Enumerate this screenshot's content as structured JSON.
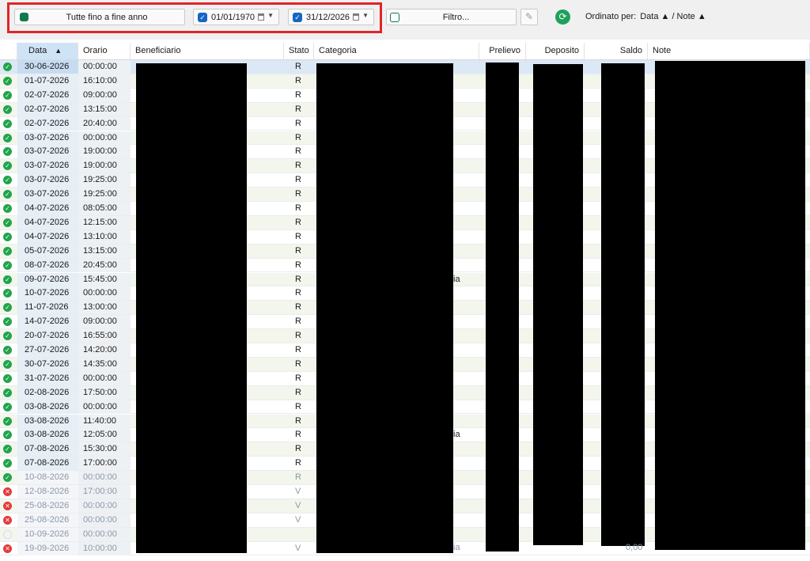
{
  "toolbar": {
    "period_label": "Tutte fino a fine anno",
    "date_from": "01/01/1970",
    "date_to": "31/12/2026",
    "filter_label": "Filtro...",
    "sort_label": "Ordinato per:",
    "sort_value": "Data ▲ / Note ▲"
  },
  "columns": {
    "date": "Data",
    "time": "Orario",
    "payee": "Beneficiario",
    "status": "Stato",
    "category": "Categoria",
    "withdrawal": "Prelievo",
    "deposit": "Deposito",
    "balance": "Saldo",
    "notes": "Note"
  },
  "colors": {
    "accent_green": "#1ea15b",
    "highlight_red": "#e2232a",
    "error": "#e23b3b"
  },
  "rows": [
    {
      "date": "30-06-2026",
      "time": "00:00:00",
      "status": "R",
      "icon": "ok"
    },
    {
      "date": "01-07-2026",
      "time": "16:10:00",
      "status": "R",
      "icon": "ok"
    },
    {
      "date": "02-07-2026",
      "time": "09:00:00",
      "status": "R",
      "icon": "ok"
    },
    {
      "date": "02-07-2026",
      "time": "13:15:00",
      "status": "R",
      "icon": "ok"
    },
    {
      "date": "02-07-2026",
      "time": "20:40:00",
      "status": "R",
      "icon": "ok"
    },
    {
      "date": "03-07-2026",
      "time": "00:00:00",
      "status": "R",
      "icon": "ok"
    },
    {
      "date": "03-07-2026",
      "time": "19:00:00",
      "status": "R",
      "icon": "ok"
    },
    {
      "date": "03-07-2026",
      "time": "19:00:00",
      "status": "R",
      "icon": "ok"
    },
    {
      "date": "03-07-2026",
      "time": "19:25:00",
      "status": "R",
      "icon": "ok"
    },
    {
      "date": "03-07-2026",
      "time": "19:25:00",
      "status": "R",
      "icon": "ok"
    },
    {
      "date": "04-07-2026",
      "time": "08:05:00",
      "status": "R",
      "icon": "ok"
    },
    {
      "date": "04-07-2026",
      "time": "12:15:00",
      "status": "R",
      "icon": "ok"
    },
    {
      "date": "04-07-2026",
      "time": "13:10:00",
      "status": "R",
      "icon": "ok"
    },
    {
      "date": "05-07-2026",
      "time": "13:15:00",
      "status": "R",
      "icon": "ok"
    },
    {
      "date": "08-07-2026",
      "time": "20:45:00",
      "status": "R",
      "icon": "ok"
    },
    {
      "date": "09-07-2026",
      "time": "15:45:00",
      "status": "R",
      "icon": "ok"
    },
    {
      "date": "10-07-2026",
      "time": "00:00:00",
      "status": "R",
      "icon": "ok"
    },
    {
      "date": "11-07-2026",
      "time": "13:00:00",
      "status": "R",
      "icon": "ok"
    },
    {
      "date": "14-07-2026",
      "time": "09:00:00",
      "status": "R",
      "icon": "ok"
    },
    {
      "date": "20-07-2026",
      "time": "16:55:00",
      "status": "R",
      "icon": "ok"
    },
    {
      "date": "27-07-2026",
      "time": "14:20:00",
      "status": "R",
      "icon": "ok"
    },
    {
      "date": "30-07-2026",
      "time": "14:35:00",
      "status": "R",
      "icon": "ok"
    },
    {
      "date": "31-07-2026",
      "time": "00:00:00",
      "status": "R",
      "icon": "ok"
    },
    {
      "date": "02-08-2026",
      "time": "17:50:00",
      "status": "R",
      "icon": "ok"
    },
    {
      "date": "03-08-2026",
      "time": "00:00:00",
      "status": "R",
      "icon": "ok"
    },
    {
      "date": "03-08-2026",
      "time": "11:40:00",
      "status": "R",
      "icon": "ok"
    },
    {
      "date": "03-08-2026",
      "time": "12:05:00",
      "status": "R",
      "icon": "ok"
    },
    {
      "date": "07-08-2026",
      "time": "15:30:00",
      "status": "R",
      "icon": "ok"
    },
    {
      "date": "07-08-2026",
      "time": "17:00:00",
      "status": "R",
      "icon": "ok"
    },
    {
      "date": "10-08-2026",
      "time": "00:00:00",
      "status": "R",
      "icon": "ok"
    },
    {
      "date": "12-08-2026",
      "time": "17:00:00",
      "status": "V",
      "icon": "err"
    },
    {
      "date": "25-08-2026",
      "time": "00:00:00",
      "status": "V",
      "icon": "err"
    },
    {
      "date": "25-08-2026",
      "time": "00:00:00",
      "status": "V",
      "icon": "err"
    },
    {
      "date": "10-09-2026",
      "time": "00:00:00",
      "status": "",
      "icon": "none"
    },
    {
      "date": "19-09-2026",
      "time": "10:00:00",
      "status": "V",
      "icon": "err"
    }
  ],
  "fragments": {
    "cat_suffix": "ia",
    "balance_last": "0,00"
  }
}
